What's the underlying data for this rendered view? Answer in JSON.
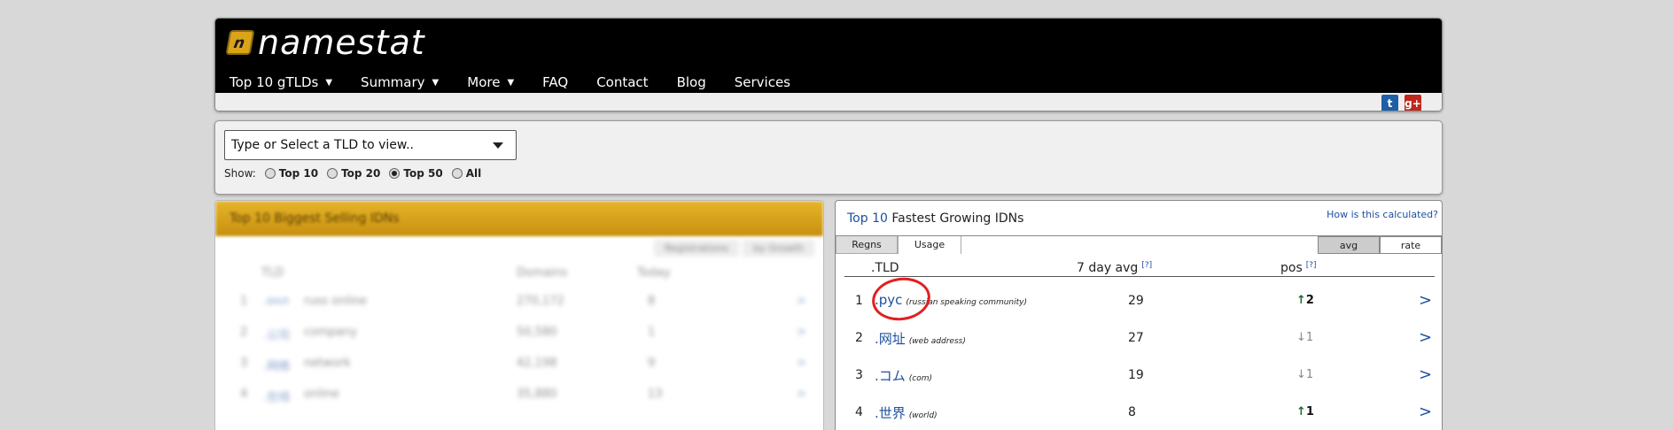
{
  "header": {
    "logo_text": "namestat",
    "logo_mark": "n",
    "nav": [
      {
        "label": "Top 10 gTLDs",
        "dropdown": true
      },
      {
        "label": "Summary",
        "dropdown": true
      },
      {
        "label": "More",
        "dropdown": true
      },
      {
        "label": "FAQ",
        "dropdown": false
      },
      {
        "label": "Contact",
        "dropdown": false
      },
      {
        "label": "Blog",
        "dropdown": false
      },
      {
        "label": "Services",
        "dropdown": false
      }
    ],
    "social": {
      "twitter": "t",
      "googleplus": "g+"
    }
  },
  "selector": {
    "placeholder": "Type or Select a TLD to view..",
    "show_label": "Show:",
    "options": [
      {
        "label": "Top 10",
        "selected": false
      },
      {
        "label": "Top 20",
        "selected": false
      },
      {
        "label": "Top 50",
        "selected": true
      },
      {
        "label": "All",
        "selected": false
      }
    ]
  },
  "left_panel": {
    "title": "Top 10 Biggest Selling IDNs",
    "tabs": [
      "Registrations",
      "by Growth"
    ],
    "headers": [
      "TLD",
      "Domains",
      "Today"
    ],
    "rows": [
      {
        "rank": "1",
        "tld": ".онл",
        "desc": "russ online",
        "domains": "270,172",
        "today": "8"
      },
      {
        "rank": "2",
        "tld": ".公司",
        "desc": "company",
        "domains": "50,580",
        "today": "1"
      },
      {
        "rank": "3",
        "tld": ".网络",
        "desc": "network",
        "domains": "42,198",
        "today": "9"
      },
      {
        "rank": "4",
        "tld": ".在线",
        "desc": "online",
        "domains": "35,880",
        "today": "13"
      }
    ]
  },
  "right_panel": {
    "title_highlight": "Top 10",
    "title_rest": " Fastest Growing IDNs",
    "how_link": "How is this calculated?",
    "tabs": [
      "Regns",
      "Usage"
    ],
    "toggle": [
      "avg",
      "rate"
    ],
    "col_tld": ".TLD",
    "col_avg": "7 day avg",
    "col_pos": "pos",
    "help": "[?]",
    "rows": [
      {
        "rank": "1",
        "tld": ".рус",
        "desc": "(russian speaking community)",
        "avg": "29",
        "arrow": "↑",
        "pos": "2",
        "dir": "up"
      },
      {
        "rank": "2",
        "tld": ".网址",
        "desc": "(web address)",
        "avg": "27",
        "arrow": "↓",
        "pos": "1",
        "dir": "down"
      },
      {
        "rank": "3",
        "tld": ".コム",
        "desc": "(com)",
        "avg": "19",
        "arrow": "↓",
        "pos": "1",
        "dir": "down"
      },
      {
        "rank": "4",
        "tld": ".世界",
        "desc": "(world)",
        "avg": "8",
        "arrow": "↑",
        "pos": "1",
        "dir": "up"
      }
    ],
    "go": ">"
  },
  "colors": {
    "accent": "#1f4fa0",
    "gold": "#d9a31a",
    "annotation": "#e02020"
  }
}
